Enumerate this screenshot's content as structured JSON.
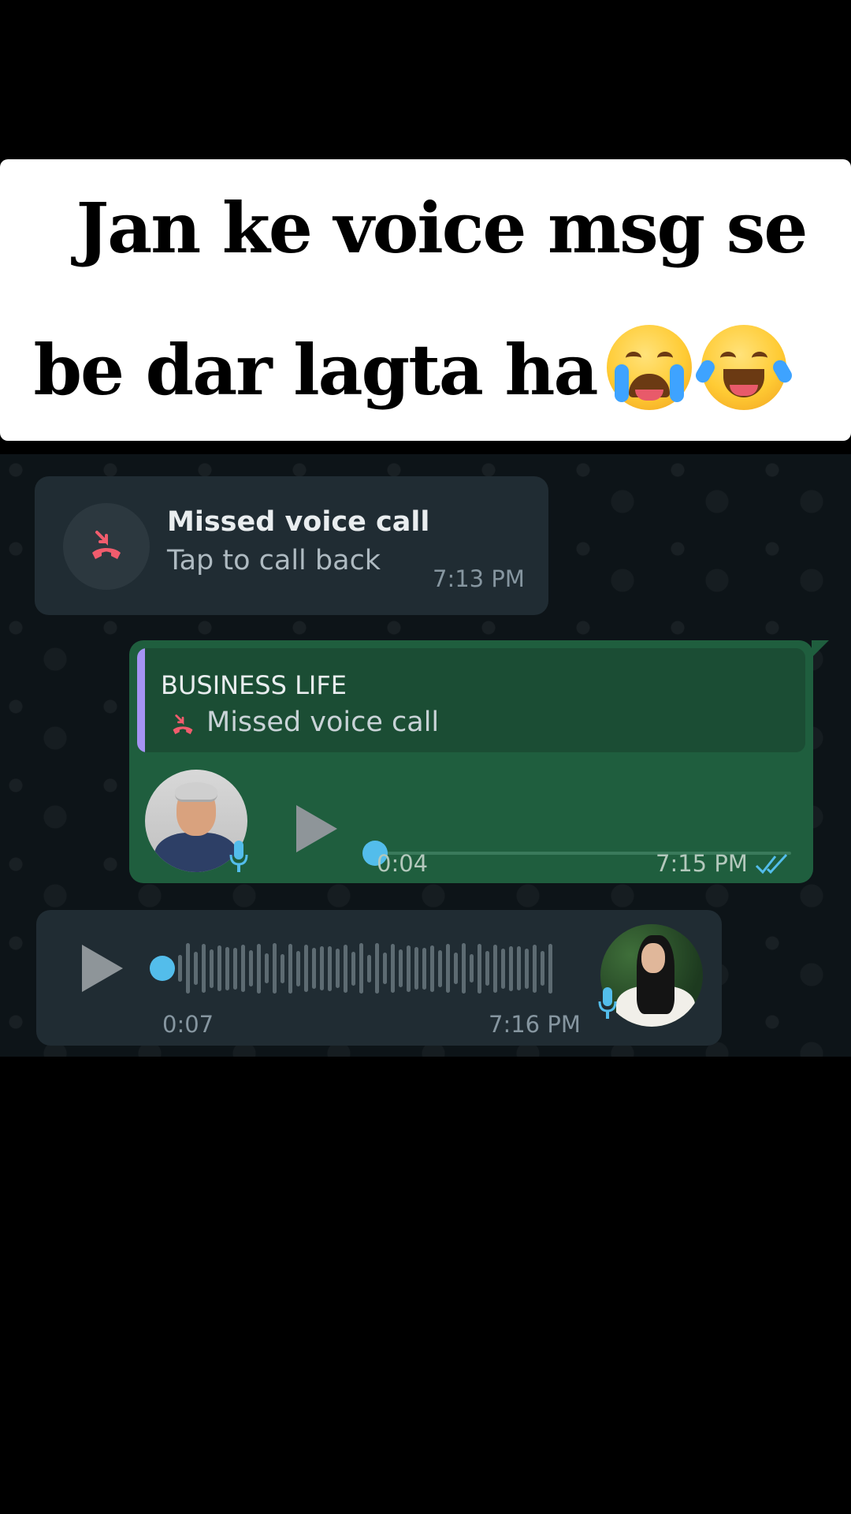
{
  "caption": {
    "line1": "Jan ke voice msg se",
    "line2": "be dar lagta ha",
    "emojis": [
      "loudly-crying-face",
      "face-with-tears-of-joy"
    ]
  },
  "missed_call": {
    "title": "Missed voice call",
    "subtitle": "Tap to call back",
    "time": "7:13 PM",
    "icon": "missed-call-icon"
  },
  "outgoing_voice": {
    "reply_to_name": "BUSINESS LIFE",
    "reply_to_text": "Missed voice call",
    "duration": "0:04",
    "time": "7:15 PM",
    "status": "read",
    "progress": 0
  },
  "incoming_voice": {
    "duration": "0:07",
    "time": "7:16 PM",
    "progress": 0
  },
  "colors": {
    "chat_bg": "#0d1418",
    "incoming_bubble": "#202c33",
    "outgoing_bubble": "#1f5e3e",
    "accent_blue": "#53bdeb",
    "missed_red": "#f15c6d",
    "quote_bar": "#a693f3"
  }
}
